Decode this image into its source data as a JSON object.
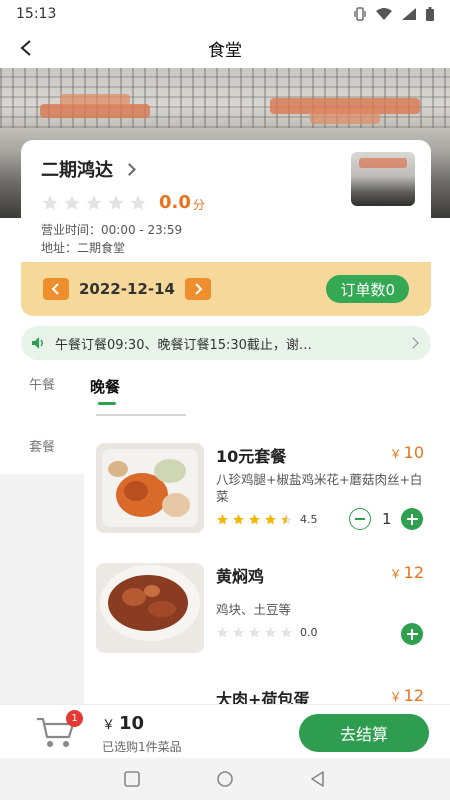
{
  "status_bar": {
    "time": "15:13"
  },
  "header": {
    "title": "食堂"
  },
  "shop": {
    "name": "二期鸿达",
    "rating": "0.0",
    "rating_unit": "分",
    "hours": "营业时间：00:00 - 23:59",
    "address": "地址：二期食堂"
  },
  "date_bar": {
    "date": "2022-12-14",
    "order_count": "订单数0"
  },
  "notice": {
    "text": "午餐订餐09:30、晚餐订餐15:30截止，谢…"
  },
  "sidebar": {
    "items": [
      {
        "label": "午餐"
      },
      {
        "label": "套餐"
      }
    ]
  },
  "tabs": {
    "active": "晚餐"
  },
  "dishes": [
    {
      "name": "10元套餐",
      "currency": "￥",
      "price": "10",
      "desc": "八珍鸡腿+椒盐鸡米花+蘑菇肉丝+白菜",
      "score": "4.5",
      "stars": 4.5,
      "quantity": "1"
    },
    {
      "name": "黄焖鸡",
      "currency": "￥",
      "price": "12",
      "desc": "鸡块、土豆等",
      "score": "0.0",
      "stars": 0
    },
    {
      "name": "大肉+荷包蛋",
      "currency": "￥",
      "price": "12"
    }
  ],
  "cart": {
    "badge": "1",
    "currency": "￥",
    "total": "10",
    "summary": "已选购1件菜品",
    "checkout_label": "去结算"
  },
  "colors": {
    "accent_green": "#2e9d4f",
    "price_orange": "#e9731c",
    "date_bg": "#f6d99a"
  }
}
